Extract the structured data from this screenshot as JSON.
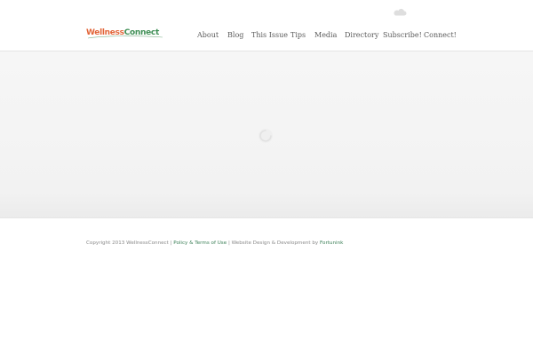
{
  "header": {
    "logo": {
      "part1": "Wellness",
      "part2": "Connect"
    },
    "nav": [
      {
        "label": "About"
      },
      {
        "label": "Blog"
      },
      {
        "label": "This Issue"
      },
      {
        "label": "Tips"
      },
      {
        "label": "Media"
      },
      {
        "label": "Directory"
      },
      {
        "label": "Subscribe!"
      },
      {
        "label": "Connect!"
      }
    ],
    "icons": {
      "weather": "cloud-icon"
    }
  },
  "hero": {
    "icon": "loading-spinner-icon"
  },
  "footer": {
    "copyright": "Copyright 2013 WellnessConnect |",
    "policy_link": "Policy & Terms of Use",
    "separator": "| Website Design & Development by",
    "credit_link": "Fortunink"
  },
  "colors": {
    "logo_orange": "#e2663a",
    "logo_green": "#3f8f55",
    "nav_text": "#5a5a5a",
    "link_green": "#3b7f57",
    "hero_bg": "#f4f4f4"
  }
}
